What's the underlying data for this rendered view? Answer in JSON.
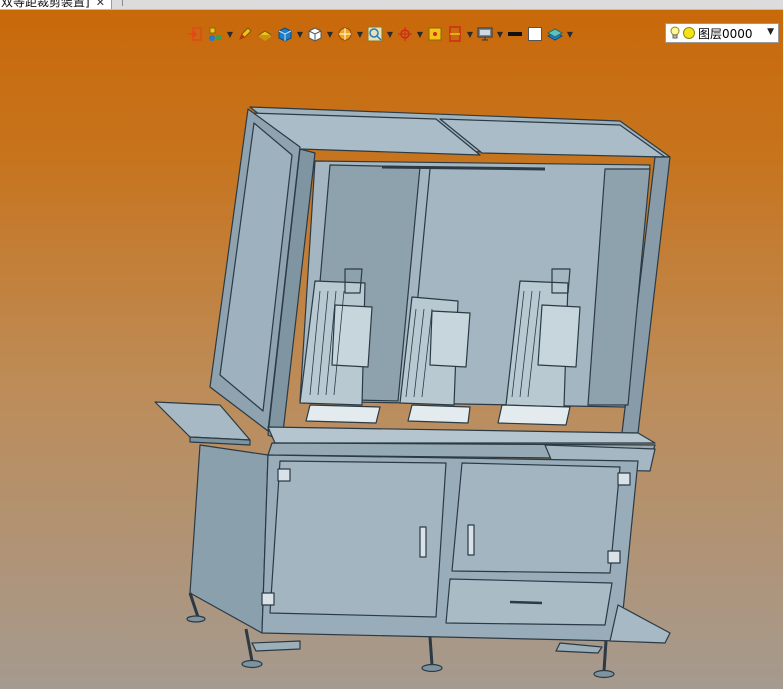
{
  "document_tab": {
    "title": "双等距裁剪装置]",
    "close_glyph": "✕"
  },
  "toolbar": {
    "buttons": [
      {
        "name": "exit-sketch-icon",
        "has_dropdown": false
      },
      {
        "name": "move-part-icon",
        "has_dropdown": true
      },
      {
        "name": "pen-icon",
        "has_dropdown": false
      },
      {
        "name": "sketch-block-icon",
        "has_dropdown": false
      },
      {
        "name": "box-view-icon",
        "has_dropdown": true
      },
      {
        "name": "cube-view-icon",
        "has_dropdown": true
      },
      {
        "name": "section-view-icon",
        "has_dropdown": true
      },
      {
        "name": "zoom-view-icon",
        "has_dropdown": true
      },
      {
        "name": "crosshair-icon",
        "has_dropdown": true
      },
      {
        "name": "snap-point-icon",
        "has_dropdown": false
      },
      {
        "name": "frame-icon",
        "has_dropdown": true
      },
      {
        "name": "display-monitor-icon",
        "has_dropdown": true
      },
      {
        "name": "line-color-icon",
        "has_dropdown": false
      },
      {
        "name": "fill-color-icon",
        "has_dropdown": false
      },
      {
        "name": "layers-icon",
        "has_dropdown": true
      }
    ],
    "colors": {
      "orange": "#e4471b",
      "blue": "#1e7ec8",
      "yellow": "#f4c21b",
      "red": "#d12a1a",
      "grey": "#555555"
    }
  },
  "layer_select": {
    "value": "图层0000"
  },
  "viewport": {
    "background_top": "#c8690a",
    "background_bottom": "#a59a8f",
    "model_color": "#8fa6b3"
  }
}
